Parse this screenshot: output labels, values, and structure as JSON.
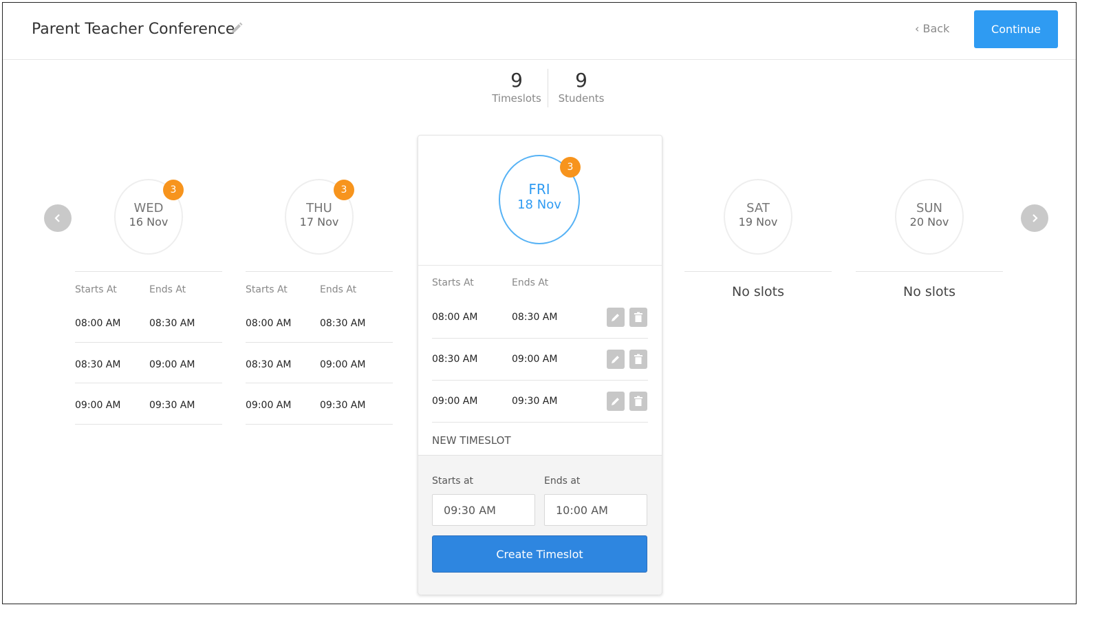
{
  "header": {
    "title": "Parent Teacher Conference",
    "back_label": "Back",
    "continue_label": "Continue"
  },
  "stats": [
    {
      "value": "9",
      "label": "Timeslots"
    },
    {
      "value": "9",
      "label": "Students"
    }
  ],
  "columns": {
    "starts_at": "Starts At",
    "ends_at": "Ends At"
  },
  "days": [
    {
      "name": "WED",
      "date": "16 Nov",
      "badge": "3",
      "slots": [
        [
          "08:00 AM",
          "08:30 AM"
        ],
        [
          "08:30 AM",
          "09:00 AM"
        ],
        [
          "09:00 AM",
          "09:30 AM"
        ]
      ]
    },
    {
      "name": "THU",
      "date": "17 Nov",
      "badge": "3",
      "slots": [
        [
          "08:00 AM",
          "08:30 AM"
        ],
        [
          "08:30 AM",
          "09:00 AM"
        ],
        [
          "09:00 AM",
          "09:30 AM"
        ]
      ]
    },
    {
      "name": "FRI",
      "date": "18 Nov",
      "badge": "3",
      "slots": [
        [
          "08:00 AM",
          "08:30 AM"
        ],
        [
          "08:30 AM",
          "09:00 AM"
        ],
        [
          "09:00 AM",
          "09:30 AM"
        ]
      ]
    },
    {
      "name": "SAT",
      "date": "19 Nov",
      "empty_text": "No slots"
    },
    {
      "name": "SUN",
      "date": "20 Nov",
      "empty_text": "No slots"
    }
  ],
  "new_timeslot": {
    "heading": "NEW TIMESLOT",
    "starts_label": "Starts at",
    "ends_label": "Ends at",
    "starts_value": "09:30 AM",
    "ends_value": "10:00 AM",
    "create_label": "Create Timeslot"
  },
  "icons": {
    "title_edit": "pencil-icon",
    "prev": "chevron-left-icon",
    "next": "chevron-right-icon",
    "edit": "pencil-icon",
    "delete": "trash-icon"
  },
  "colors": {
    "accent": "#2f9bf2",
    "badge": "#f7941d",
    "primary_button": "#2e86e0"
  }
}
